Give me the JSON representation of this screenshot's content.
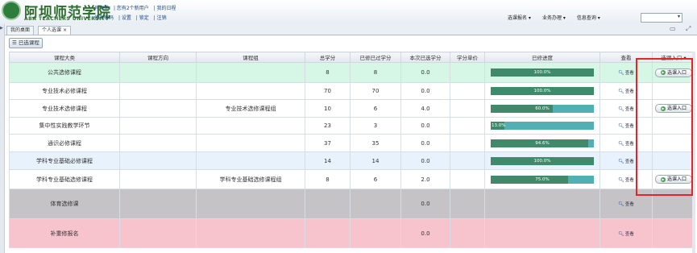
{
  "header": {
    "logo_title": "阿坝师范学院",
    "logo_subtitle": "ABA TEACHERS UNIVERSITY",
    "user_links_1": [
      "肖同学",
      "| 您有2个新用户",
      "| 我的日程"
    ],
    "user_links_2": [
      "修改密码",
      "| 设置",
      "| 锁定",
      "| 注销"
    ],
    "menus": [
      "选课报名",
      "业务办理",
      "信息查询"
    ]
  },
  "tabs": [
    {
      "label": "我的桌面"
    },
    {
      "label": "个人选课",
      "close": "×"
    }
  ],
  "toolbar": {
    "selected_button": "已选课程"
  },
  "table": {
    "headers": [
      "课程大类",
      "课程方向",
      "课程组",
      "总学分",
      "已修已过学分",
      "本次已选学分",
      "学分单价",
      "已修进度",
      "查看",
      "选课入口"
    ],
    "view_label": "查看",
    "entry_label": "选课入口",
    "rows": [
      {
        "category": "公共选修课程",
        "direction": "",
        "group": "",
        "total": "8",
        "passed": "8",
        "selected": "0.0",
        "price": "",
        "progress": 100,
        "progress_text": "100.0%",
        "view": true,
        "entry": true,
        "style": "green"
      },
      {
        "category": "专业技术必修课程",
        "direction": "",
        "group": "",
        "total": "70",
        "passed": "70",
        "selected": "0.0",
        "price": "",
        "progress": 100,
        "progress_text": "100.0%",
        "view": true,
        "entry": false,
        "style": "white"
      },
      {
        "category": "专业技术选修课程",
        "direction": "",
        "group": "专业技术选修课程组",
        "total": "10",
        "passed": "6",
        "selected": "4.0",
        "price": "",
        "progress": 60,
        "progress_text": "60.0%",
        "view": true,
        "entry": true,
        "style": "white"
      },
      {
        "category": "集中性实践教学环节",
        "direction": "",
        "group": "",
        "total": "23",
        "passed": "3",
        "selected": "0.0",
        "price": "",
        "progress": 13,
        "progress_text": "13.0%",
        "view": true,
        "entry": false,
        "style": "white"
      },
      {
        "category": "通识必修课程",
        "direction": "",
        "group": "",
        "total": "37",
        "passed": "35",
        "selected": "0.0",
        "price": "",
        "progress": 94.6,
        "progress_text": "94.6%",
        "view": true,
        "entry": false,
        "style": "white"
      },
      {
        "category": "学科专业基础必修课程",
        "direction": "",
        "group": "",
        "total": "14",
        "passed": "14",
        "selected": "0.0",
        "price": "",
        "progress": 100,
        "progress_text": "100.0%",
        "view": true,
        "entry": false,
        "style": "blue"
      },
      {
        "category": "学科专业基础选修课程",
        "direction": "",
        "group": "学科专业基础选修课程组",
        "total": "8",
        "passed": "6",
        "selected": "2.0",
        "price": "",
        "progress": 75,
        "progress_text": "75.0%",
        "view": true,
        "entry": true,
        "style": "white"
      },
      {
        "category": "体育选修课",
        "direction": "",
        "group": "",
        "total": "",
        "passed": "",
        "selected": "0.0",
        "price": "",
        "progress": null,
        "progress_text": "",
        "view": true,
        "entry": false,
        "style": "gray"
      },
      {
        "category": "补重修报名",
        "direction": "",
        "group": "",
        "total": "",
        "passed": "",
        "selected": "0.0",
        "price": "",
        "progress": null,
        "progress_text": "",
        "view": true,
        "entry": false,
        "style": "pink"
      }
    ]
  },
  "colors": {
    "progress_fill": "#3e8a6a",
    "progress_track": "#52b0b4",
    "highlight_box": "#e0262b"
  }
}
